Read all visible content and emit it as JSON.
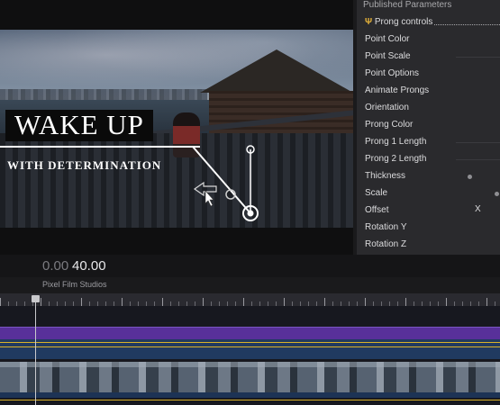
{
  "viewer": {
    "title": "WAKE UP",
    "subtitle": "WITH DETERMINATION"
  },
  "inspector": {
    "header": "Published Parameters",
    "prong_icon_glyph": "Ψ",
    "params": [
      "Prong controls",
      "Point Color",
      "Point Scale",
      "Point Options",
      "Animate Prongs",
      "Orientation",
      "Prong Color",
      "Prong 1 Length",
      "Prong 2 Length",
      "Thickness",
      "Scale",
      "Offset",
      "Rotation Y",
      "Rotation Z"
    ],
    "offset_axis": "X"
  },
  "timecode": {
    "dim": "0.00",
    "bright": "40.00"
  },
  "project": "Pixel Film Studios",
  "colors": {
    "accent_purple": "#58309a",
    "accent_gold": "#d9b22a",
    "prong_icon": "#e3b13a"
  }
}
